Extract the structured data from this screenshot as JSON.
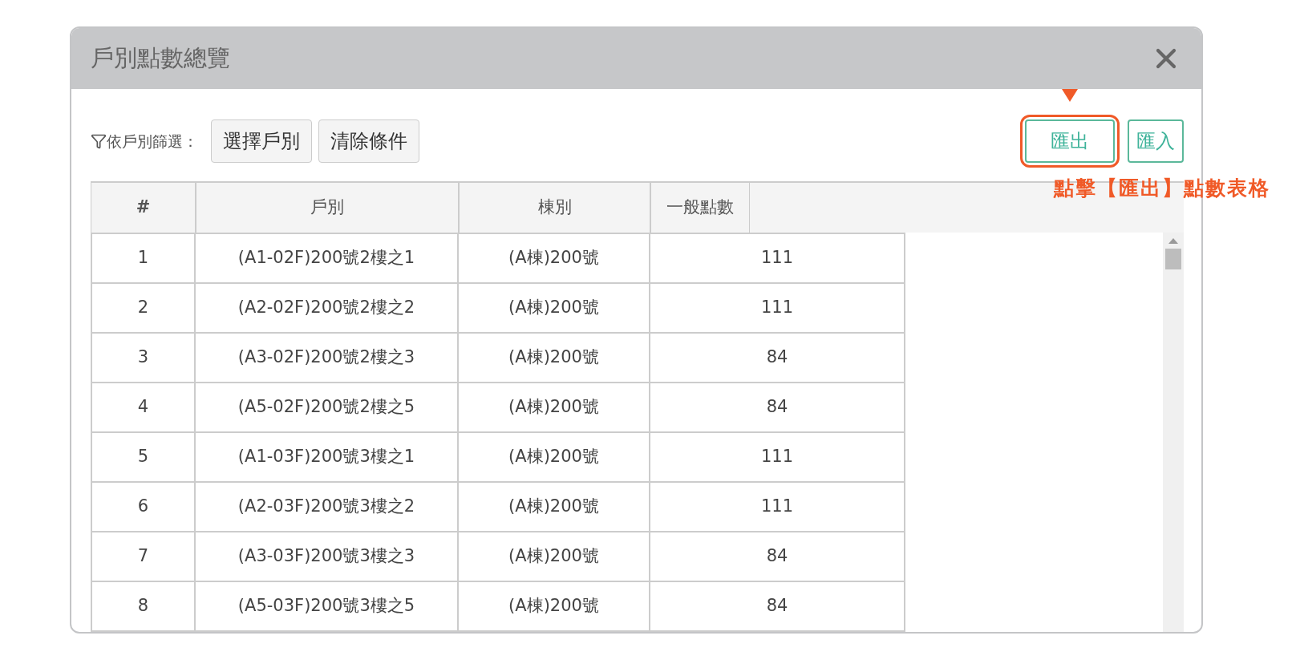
{
  "dialog": {
    "title": "戶別點數總覽"
  },
  "filter": {
    "label": "依戶別篩選：",
    "buttons": [
      "選擇戶別",
      "清除條件"
    ]
  },
  "actions": [
    {
      "label": "匯出",
      "highlighted": true
    },
    {
      "label": "匯入",
      "highlighted": false
    }
  ],
  "annotation": {
    "text": "點擊【匯出】點數表格"
  },
  "table": {
    "columns": [
      "#",
      "戶別",
      "棟別",
      "一般點數"
    ],
    "rows": [
      [
        "1",
        "(A1-02F)200號2樓之1",
        "(A棟)200號",
        "111"
      ],
      [
        "2",
        "(A2-02F)200號2樓之2",
        "(A棟)200號",
        "111"
      ],
      [
        "3",
        "(A3-02F)200號2樓之3",
        "(A棟)200號",
        "84"
      ],
      [
        "4",
        "(A5-02F)200號2樓之5",
        "(A棟)200號",
        "84"
      ],
      [
        "5",
        "(A1-03F)200號3樓之1",
        "(A棟)200號",
        "111"
      ],
      [
        "6",
        "(A2-03F)200號3樓之2",
        "(A棟)200號",
        "111"
      ],
      [
        "7",
        "(A3-03F)200號3樓之3",
        "(A棟)200號",
        "84"
      ],
      [
        "8",
        "(A5-03F)200號3樓之5",
        "(A棟)200號",
        "84"
      ]
    ]
  }
}
